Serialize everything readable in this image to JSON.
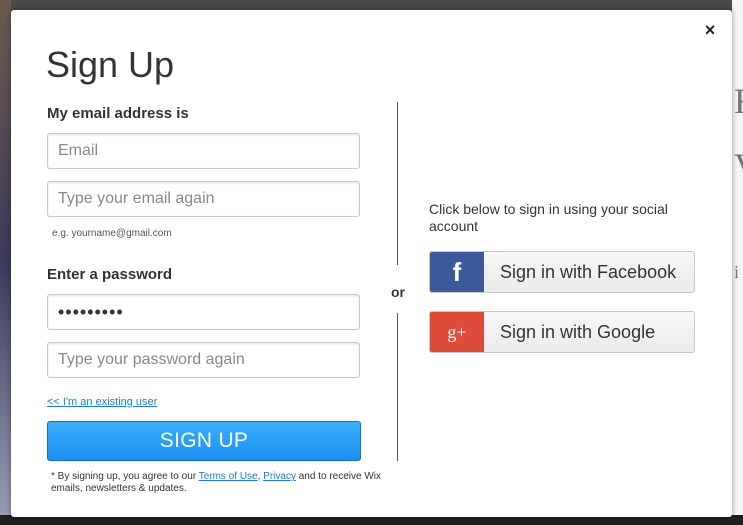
{
  "modal": {
    "close_label": "×",
    "title": "Sign Up"
  },
  "email_section": {
    "label": "My email address is",
    "email_placeholder": "Email",
    "email_confirm_placeholder": "Type your email again",
    "hint": "e.g. yourname@gmail.com"
  },
  "password_section": {
    "label": "Enter a password",
    "password_value": "•••••••••",
    "password_confirm_placeholder": "Type your password again"
  },
  "existing_user_link": "<< I'm an existing user",
  "signup_button": "SIGN UP",
  "terms": {
    "prefix": "* By signing up, you agree to our ",
    "terms_link": "Terms of Use",
    "comma": ", ",
    "privacy_link": "Privacy",
    "suffix": " and to receive Wix emails, newsletters & updates."
  },
  "or_label": "or",
  "social": {
    "prompt": "Click below to sign in using your social account",
    "facebook_icon": "f",
    "facebook_label": "Sign in with Facebook",
    "google_icon": "g+",
    "google_label": "Sign in with Google"
  },
  "background": {
    "right_glyph_1": "F",
    "right_glyph_2": "V",
    "right_glyph_3": "i"
  },
  "colors": {
    "signup_blue": "#2196f3",
    "facebook_blue": "#3b5998",
    "google_red": "#dd4b39",
    "link_blue": "#1a7bd6"
  }
}
